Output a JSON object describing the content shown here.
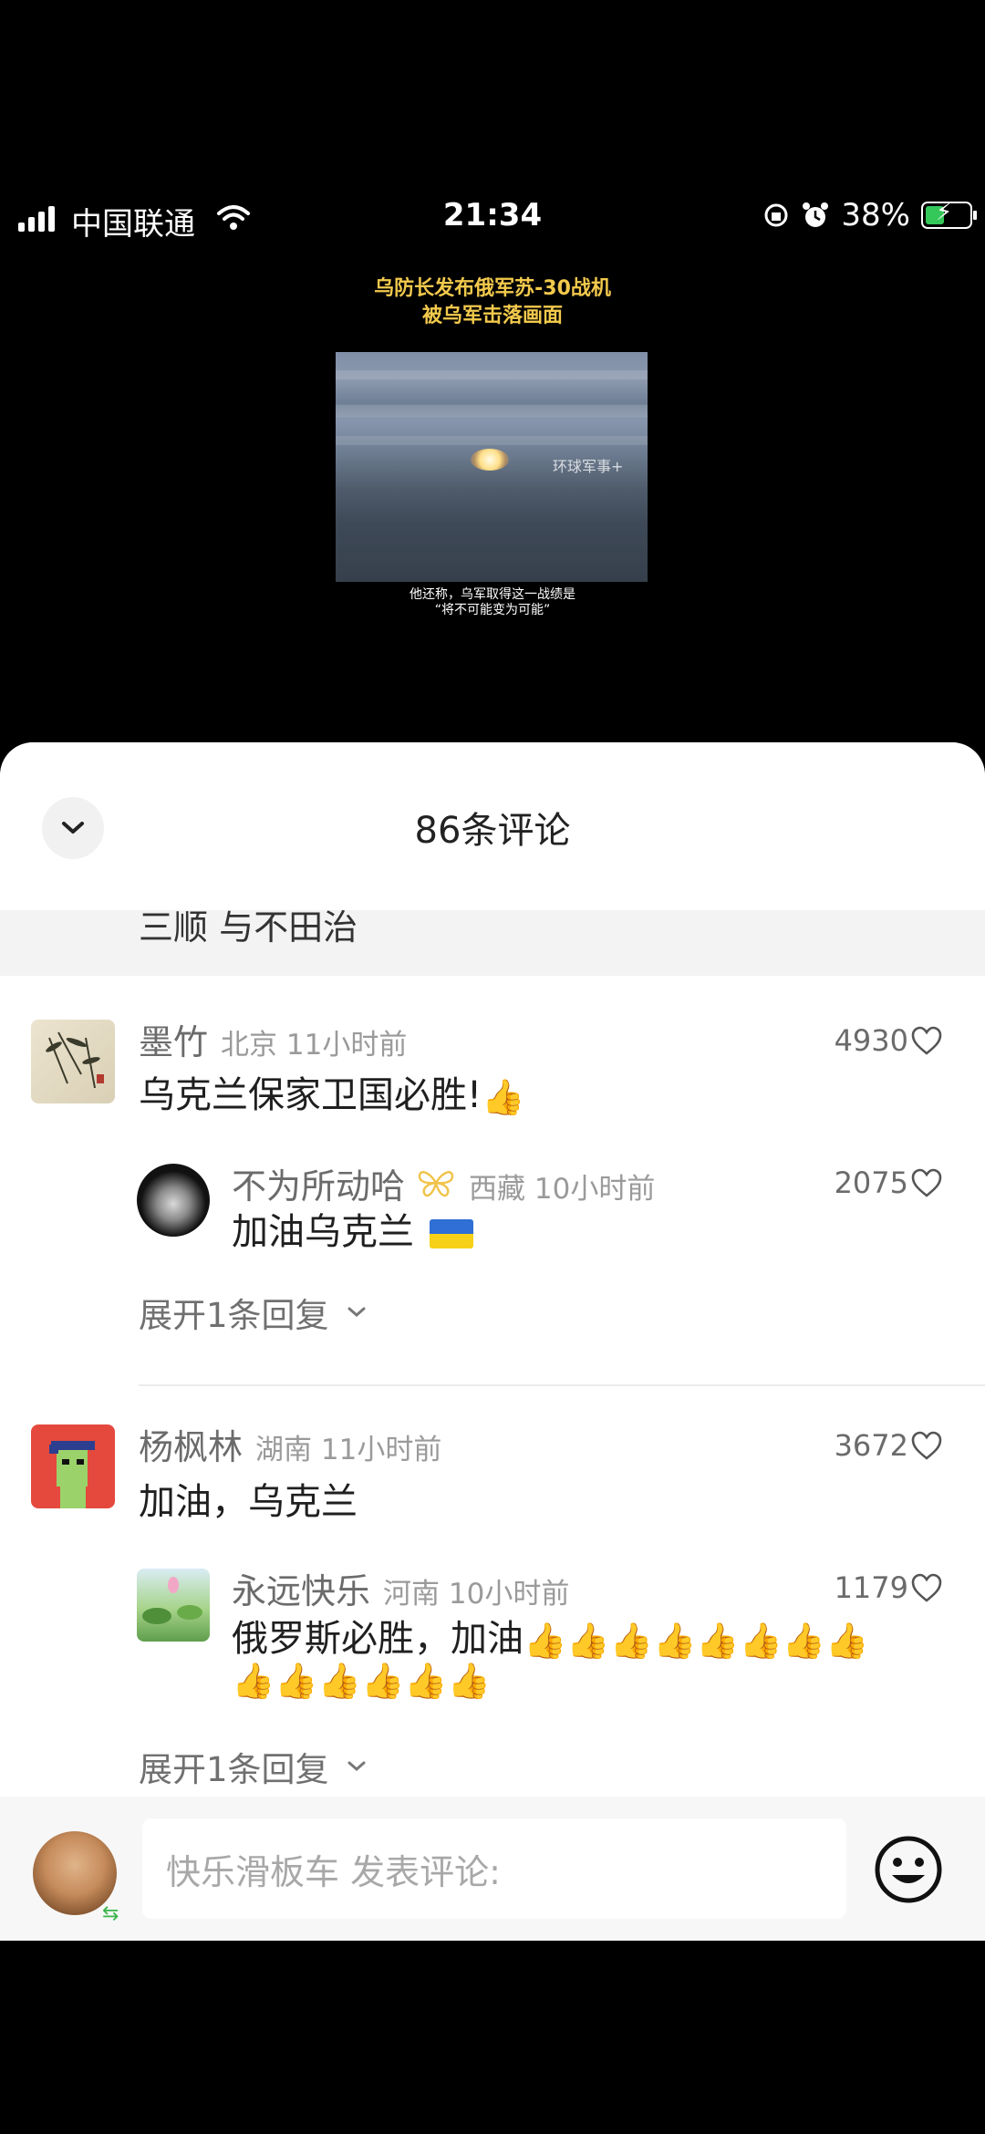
{
  "status_bar": {
    "carrier": "中国联通",
    "time": "21:34",
    "battery": "38%"
  },
  "video": {
    "title_line1": "乌防长发布俄军苏-30战机",
    "title_line2": "被乌军击落画面",
    "watermark": "环球军事+",
    "caption_line1": "他还称，乌军取得这一战绩是",
    "caption_line2": "“将不可能变为可能”"
  },
  "sheet": {
    "title": "86条评论",
    "cutoff_text": "三顺 与不田治"
  },
  "comments": [
    {
      "user": "墨竹",
      "location": "北京 11小时前",
      "likes": "4930",
      "text": "乌克兰保家卫国必胜!",
      "reply": {
        "user": "不为所动哈",
        "location": "西藏 10小时前",
        "likes": "2075",
        "text": "加油乌克兰"
      },
      "expand": "展开1条回复"
    },
    {
      "user": "杨枫林",
      "location": "湖南 11小时前",
      "likes": "3672",
      "text": "加油，乌克兰",
      "reply": {
        "user": "永远快乐",
        "location": "河南 10小时前",
        "likes": "1179",
        "text": "俄罗斯必胜，加油"
      },
      "expand": "展开1条回复"
    }
  ],
  "input": {
    "placeholder": "快乐滑板车 发表评论:"
  },
  "icons": {
    "collapse": "chevron-down-icon",
    "like": "heart-icon",
    "emoji": "smiley-icon",
    "thumbs": "thumbs-up-emoji",
    "flag": "ukraine-flag-emoji"
  },
  "colors": {
    "video_title": "#f2c94c",
    "battery_fill": "#34c759",
    "meta_gray": "#9a9a9a"
  }
}
